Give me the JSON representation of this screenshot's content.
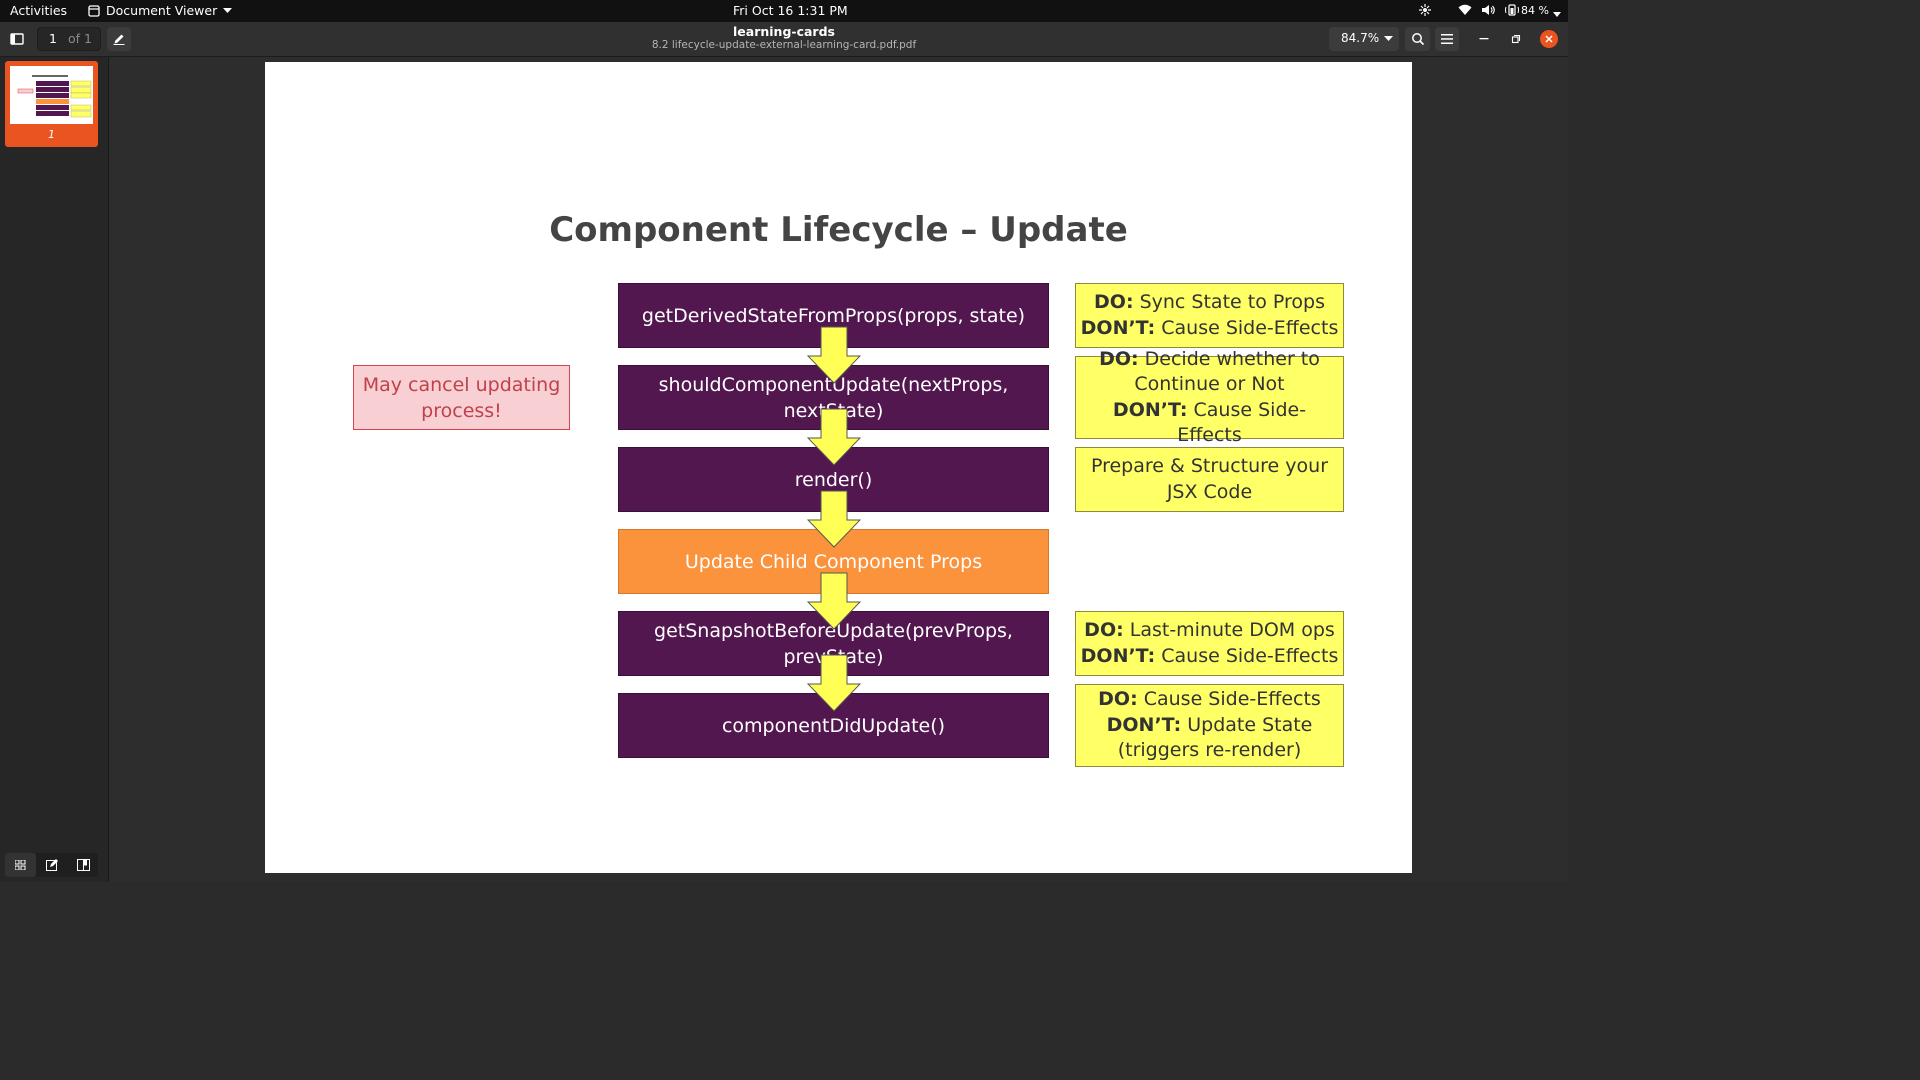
{
  "topbar": {
    "activities": "Activities",
    "app_menu": "Document Viewer",
    "clock": "Fri Oct 16  1:31 PM",
    "battery": "84 %"
  },
  "header": {
    "page_current": "1",
    "page_total": "of 1",
    "title": "learning-cards",
    "subtitle": "8.2 lifecycle-update-external-learning-card.pdf.pdf",
    "zoom": "84.7%"
  },
  "sidebar": {
    "thumb_label": "1"
  },
  "slide": {
    "title": "Component Lifecycle – Update",
    "note": "May cancel updating process!",
    "steps": [
      "getDerivedStateFromProps(props, state)",
      "shouldComponentUpdate(nextProps, nextState)",
      "render()",
      "Update Child Component Props",
      "getSnapshotBeforeUpdate(prevProps, prevState)",
      "componentDidUpdate()"
    ],
    "tips": {
      "t1_do_label": "DO:",
      "t1_do": " Sync State to Props",
      "t1_dont_label": "DON’T:",
      "t1_dont": " Cause Side-Effects",
      "t2_do_label": "DO:",
      "t2_do": " Decide whether to Continue or Not",
      "t2_dont_label": "DON’T:",
      "t2_dont": " Cause Side-Effects",
      "t3": "Prepare & Structure your JSX Code",
      "t4_do_label": "DO:",
      "t4_do": " Last-minute DOM ops",
      "t4_dont_label": "DON’T:",
      "t4_dont": " Cause Side-Effects",
      "t5_do_label": "DO:",
      "t5_do": " Cause Side-Effects",
      "t5_dont_label": "DON’T:",
      "t5_dont": " Update State (triggers re-render)"
    }
  },
  "colors": {
    "purple": "#52174f",
    "orange": "#fb923c",
    "yellow": "#ffff66",
    "note_bg": "#f8d0d3",
    "note_border": "#d9434d",
    "accent": "#e95420"
  }
}
